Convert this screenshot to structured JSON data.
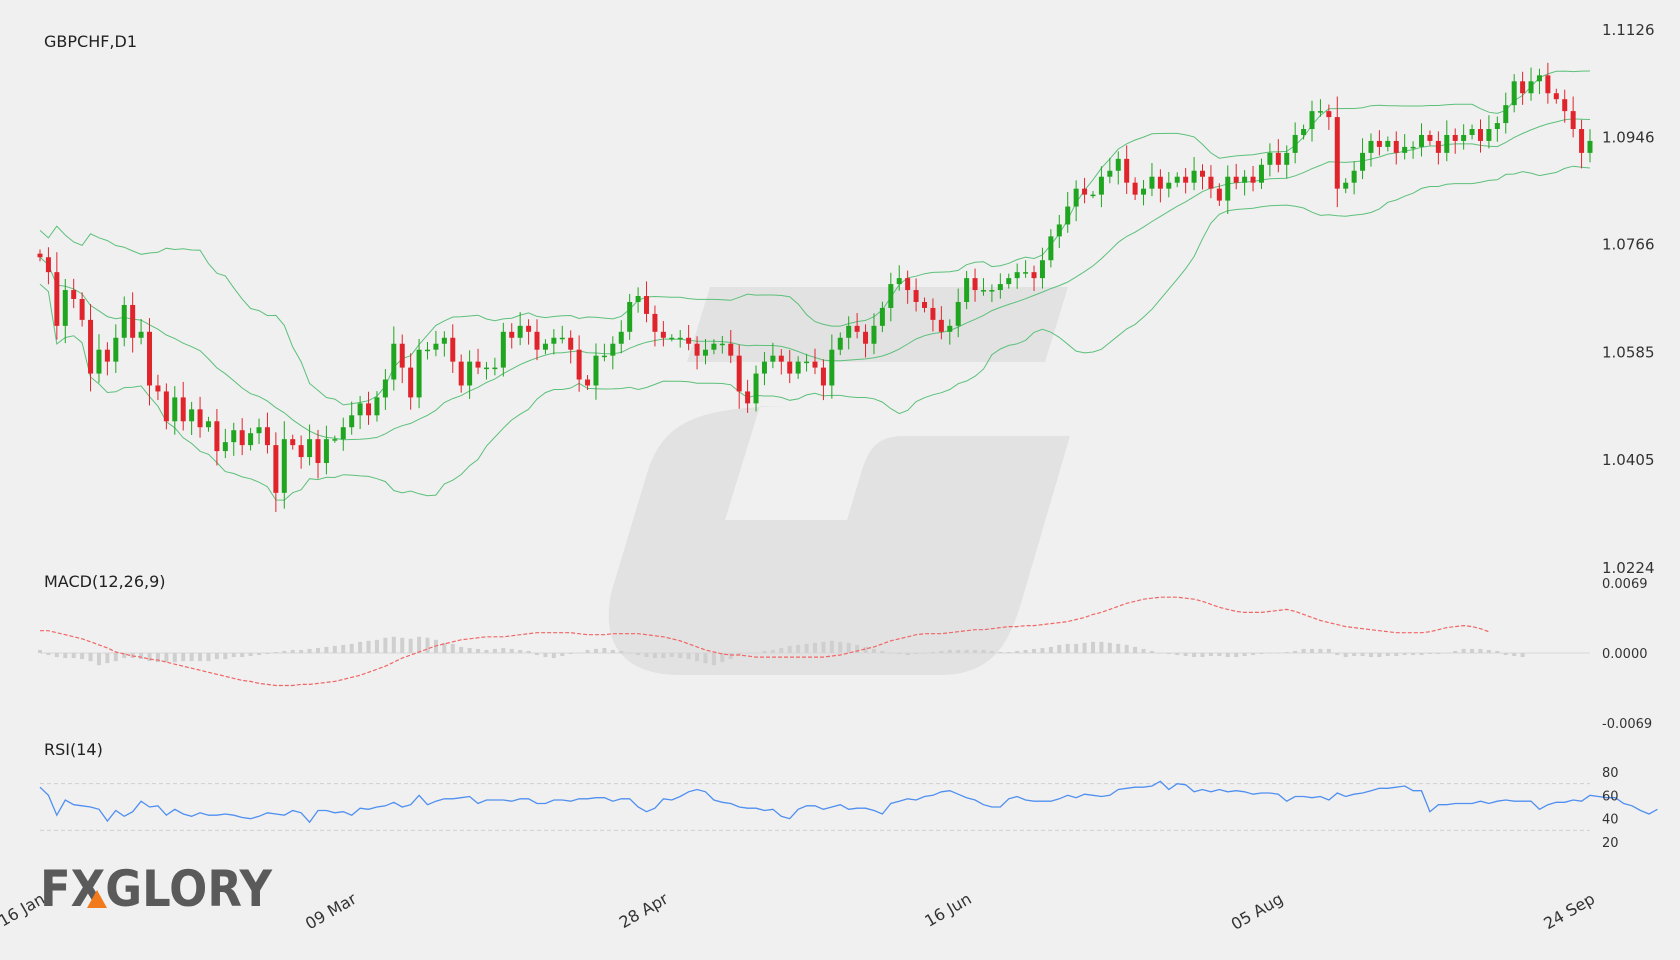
{
  "main_title": "GBPCHF,D1",
  "macd_title": "MACD(12,26,9)",
  "rsi_title": "RSI(14)",
  "logo_text": "FXGLORY",
  "colors": {
    "background": "#f0f0f0",
    "bull": "#1fa51f",
    "bear": "#e0242c",
    "bollinger": "#5cc07a",
    "macd_signal": "#f26565",
    "macd_histogram": "#cfcfcf",
    "rsi_line": "#4f8ff0",
    "axis_text": "#333333"
  },
  "chart_data": [
    {
      "type": "candlestick",
      "title": "GBPCHF,D1",
      "ylim": [
        1.0224,
        1.1126
      ],
      "y_ticks": [
        "1.1126",
        "1.0946",
        "1.0766",
        "1.0585",
        "1.0405",
        "1.0224"
      ],
      "x_tick_labels": [
        "16 Jan",
        "09 Mar",
        "28 Apr",
        "16 Jun",
        "05 Aug",
        "24 Sep"
      ],
      "x_tick_index": [
        0,
        37,
        74,
        110,
        147,
        184
      ],
      "indicator": "Bollinger Bands",
      "grid": false,
      "closes": [
        1.0745,
        1.072,
        1.063,
        1.069,
        1.0675,
        1.064,
        1.055,
        1.059,
        1.057,
        1.061,
        1.0665,
        1.061,
        1.062,
        1.053,
        1.052,
        1.047,
        1.051,
        1.047,
        1.049,
        1.046,
        1.047,
        1.042,
        1.0435,
        1.0455,
        1.043,
        1.045,
        1.046,
        1.043,
        1.035,
        1.044,
        1.043,
        1.041,
        1.044,
        1.04,
        1.044,
        1.044,
        1.046,
        1.048,
        1.05,
        1.048,
        1.051,
        1.054,
        1.06,
        1.056,
        1.051,
        1.059,
        1.059,
        1.06,
        1.061,
        1.057,
        1.053,
        1.057,
        1.056,
        1.056,
        1.056,
        1.062,
        1.061,
        1.063,
        1.062,
        1.059,
        1.06,
        1.061,
        1.061,
        1.059,
        1.054,
        1.053,
        1.058,
        1.058,
        1.06,
        1.062,
        1.067,
        1.068,
        1.065,
        1.062,
        1.061,
        1.061,
        1.061,
        1.06,
        1.058,
        1.059,
        1.06,
        1.06,
        1.058,
        1.052,
        1.05,
        1.055,
        1.057,
        1.058,
        1.057,
        1.055,
        1.057,
        1.057,
        1.056,
        1.053,
        1.059,
        1.061,
        1.063,
        1.062,
        1.06,
        1.063,
        1.066,
        1.07,
        1.071,
        1.069,
        1.067,
        1.066,
        1.064,
        1.062,
        1.063,
        1.067,
        1.071,
        1.069,
        1.069,
        1.069,
        1.07,
        1.071,
        1.072,
        1.072,
        1.071,
        1.074,
        1.078,
        1.08,
        1.083,
        1.086,
        1.085,
        1.085,
        1.088,
        1.089,
        1.091,
        1.087,
        1.085,
        1.086,
        1.088,
        1.086,
        1.087,
        1.088,
        1.087,
        1.089,
        1.088,
        1.086,
        1.084,
        1.088,
        1.087,
        1.088,
        1.087,
        1.09,
        1.092,
        1.09,
        1.092,
        1.095,
        1.096,
        1.099,
        1.099,
        1.098,
        1.086,
        1.087,
        1.089,
        1.092,
        1.094,
        1.093,
        1.094,
        1.092,
        1.093,
        1.093,
        1.095,
        1.094,
        1.092,
        1.095,
        1.094,
        1.095,
        1.096,
        1.094,
        1.096,
        1.097,
        1.1,
        1.104,
        1.102,
        1.104,
        1.105,
        1.102,
        1.101,
        1.099,
        1.096,
        1.092,
        1.094
      ]
    },
    {
      "type": "line",
      "title": "MACD(12,26,9)",
      "ylim": [
        -0.0069,
        0.0069
      ],
      "y_ticks": [
        "0.0069",
        "0.0000",
        "-0.0069"
      ],
      "series": [
        {
          "name": "signal",
          "values": [
            0.0022,
            0.0022,
            0.002,
            0.0018,
            0.0016,
            0.0014,
            0.0011,
            0.0008,
            0.0005,
            0.0001,
            -0.0001,
            -0.0003,
            -0.0004,
            -0.0006,
            -0.0007,
            -0.0009,
            -0.0011,
            -0.0013,
            -0.0015,
            -0.0017,
            -0.0019,
            -0.0021,
            -0.0023,
            -0.0025,
            -0.0027,
            -0.0028,
            -0.003,
            -0.0031,
            -0.0032,
            -0.0032,
            -0.0032,
            -0.0031,
            -0.0031,
            -0.003,
            -0.0029,
            -0.0028,
            -0.0026,
            -0.0024,
            -0.0022,
            -0.0019,
            -0.0016,
            -0.0013,
            -0.0009,
            -0.0005,
            -0.0002,
            0.0001,
            0.0004,
            0.0007,
            0.0009,
            0.0011,
            0.0013,
            0.0014,
            0.0015,
            0.0016,
            0.0016,
            0.0016,
            0.0017,
            0.0018,
            0.0019,
            0.002,
            0.002,
            0.002,
            0.002,
            0.002,
            0.0019,
            0.0018,
            0.0018,
            0.0018,
            0.0019,
            0.0019,
            0.0019,
            0.0019,
            0.0018,
            0.0017,
            0.0016,
            0.0014,
            0.0012,
            0.0009,
            0.0006,
            0.0003,
            0.0001,
            -0.0001,
            -0.0002,
            -0.0002,
            -0.0003,
            -0.0004,
            -0.0004,
            -0.0004,
            -0.0004,
            -0.0004,
            -0.0004,
            -0.0004,
            -0.0004,
            -0.0004,
            -0.0003,
            -0.0002,
            0.0,
            0.0002,
            0.0004,
            0.0006,
            0.0009,
            0.0012,
            0.0014,
            0.0016,
            0.0018,
            0.0019,
            0.0019,
            0.0019,
            0.002,
            0.0021,
            0.0022,
            0.0023,
            0.0023,
            0.0024,
            0.0025,
            0.0026,
            0.0026,
            0.0027,
            0.0027,
            0.0028,
            0.0029,
            0.003,
            0.0031,
            0.0033,
            0.0035,
            0.0038,
            0.004,
            0.0043,
            0.0046,
            0.0049,
            0.0051,
            0.0053,
            0.0054,
            0.0055,
            0.0055,
            0.0055,
            0.0054,
            0.0053,
            0.0051,
            0.0048,
            0.0045,
            0.0043,
            0.0041,
            0.004,
            0.004,
            0.004,
            0.0041,
            0.0042,
            0.0043,
            0.0041,
            0.0038,
            0.0035,
            0.0032,
            0.003,
            0.0028,
            0.0026,
            0.0025,
            0.0024,
            0.0023,
            0.0022,
            0.0021,
            0.002,
            0.002,
            0.002,
            0.002,
            0.0021,
            0.0023,
            0.0025,
            0.0026,
            0.0027,
            0.0026,
            0.0024,
            0.0021
          ]
        },
        {
          "name": "histogram",
          "values": [
            0.0003,
            -0.0002,
            -0.0004,
            -0.0005,
            -0.0005,
            -0.0006,
            -0.0008,
            -0.0012,
            -0.001,
            -0.0008,
            -0.0005,
            -0.0005,
            -0.0006,
            -0.0008,
            -0.0009,
            -0.0009,
            -0.0009,
            -0.0008,
            -0.0008,
            -0.0008,
            -0.0008,
            -0.0006,
            -0.0006,
            -0.0004,
            -0.0004,
            -0.0003,
            -0.0002,
            -0.0001,
            0.0001,
            0.0002,
            0.0003,
            0.0003,
            0.0004,
            0.0005,
            0.0006,
            0.0007,
            0.0008,
            0.0009,
            0.0011,
            0.0012,
            0.0013,
            0.0015,
            0.0016,
            0.0015,
            0.0014,
            0.0016,
            0.0015,
            0.0013,
            0.001,
            0.0009,
            0.0006,
            0.0005,
            0.0004,
            0.0003,
            0.0004,
            0.0005,
            0.0004,
            0.0003,
            0.0002,
            -0.0002,
            -0.0004,
            -0.0005,
            -0.0003,
            -0.0001,
            0.0,
            0.0003,
            0.0004,
            0.0005,
            0.0003,
            0.0002,
            0.0,
            -0.0002,
            -0.0004,
            -0.0005,
            -0.0005,
            -0.0004,
            -0.0005,
            -0.0006,
            -0.0008,
            -0.001,
            -0.0012,
            -0.0009,
            -0.0006,
            -0.0002,
            0.0,
            0.0,
            0.0002,
            0.0003,
            0.0005,
            0.0007,
            0.0008,
            0.0009,
            0.001,
            0.0011,
            0.0012,
            0.0011,
            0.001,
            0.0008,
            0.0006,
            0.0004,
            0.0002,
            0.0,
            -0.0001,
            -0.0002,
            -0.0001,
            0.0,
            0.0001,
            0.0002,
            0.0003,
            0.0003,
            0.0003,
            0.0003,
            0.0003,
            0.0002,
            0.0001,
            0.0001,
            0.0002,
            0.0003,
            0.0004,
            0.0005,
            0.0006,
            0.0008,
            0.0009,
            0.0009,
            0.001,
            0.0011,
            0.0011,
            0.001,
            0.0009,
            0.0008,
            0.0006,
            0.0004,
            0.0002,
            0.0,
            -0.0001,
            -0.0002,
            -0.0003,
            -0.0004,
            -0.0004,
            -0.0003,
            -0.0003,
            -0.0004,
            -0.0004,
            -0.0003,
            -0.0002,
            -0.0001,
            0.0,
            0.0,
            0.0001,
            0.0002,
            0.0004,
            0.0004,
            0.0004,
            0.0004,
            -0.0002,
            -0.0004,
            -0.0003,
            -0.0003,
            -0.0004,
            -0.0004,
            -0.0003,
            -0.0003,
            -0.0002,
            -0.0002,
            -0.0002,
            -0.0001,
            -0.0001,
            0.0,
            0.0002,
            0.0004,
            0.0004,
            0.0004,
            0.0003,
            0.0002,
            -0.0002,
            -0.0003,
            -0.0004
          ]
        }
      ]
    },
    {
      "type": "line",
      "title": "RSI(14)",
      "ylim": [
        20,
        80
      ],
      "y_ticks": [
        "80",
        "60",
        "40",
        "20"
      ],
      "guides": [
        70,
        30
      ],
      "series": [
        {
          "name": "RSI",
          "values": [
            67,
            60,
            43,
            56,
            52,
            51,
            50,
            48,
            38,
            47,
            42,
            46,
            55,
            50,
            51,
            43,
            48,
            44,
            42,
            45,
            43,
            43,
            44,
            43,
            41,
            40,
            42,
            45,
            44,
            43,
            47,
            45,
            37,
            47,
            47,
            45,
            46,
            43,
            49,
            48,
            50,
            51,
            54,
            50,
            52,
            60,
            52,
            55,
            57,
            57,
            58,
            59,
            53,
            56,
            56,
            56,
            55,
            57,
            57,
            53,
            53,
            56,
            56,
            55,
            57,
            57,
            58,
            58,
            55,
            57,
            57,
            50,
            46,
            49,
            57,
            56,
            59,
            63,
            65,
            63,
            56,
            54,
            53,
            50,
            49,
            49,
            47,
            48,
            42,
            40,
            48,
            51,
            51,
            48,
            50,
            52,
            48,
            49,
            49,
            47,
            44,
            53,
            55,
            57,
            56,
            59,
            60,
            63,
            64,
            61,
            58,
            56,
            52,
            50,
            50,
            57,
            59,
            56,
            55,
            55,
            55,
            57,
            60,
            58,
            61,
            60,
            59,
            60,
            65,
            66,
            67,
            67,
            68,
            72,
            65,
            70,
            69,
            63,
            65,
            63,
            65,
            63,
            64,
            63,
            61,
            62,
            62,
            61,
            55,
            59,
            59,
            58,
            59,
            56,
            62,
            59,
            61,
            62,
            64,
            66,
            66,
            67,
            68,
            64,
            64,
            46,
            52,
            52,
            53,
            53,
            53,
            55,
            53,
            55,
            56,
            55,
            55,
            55,
            48,
            52,
            54,
            54,
            56,
            55,
            60,
            59,
            58,
            58,
            53,
            51,
            47,
            44,
            48
          ]
        }
      ]
    }
  ]
}
